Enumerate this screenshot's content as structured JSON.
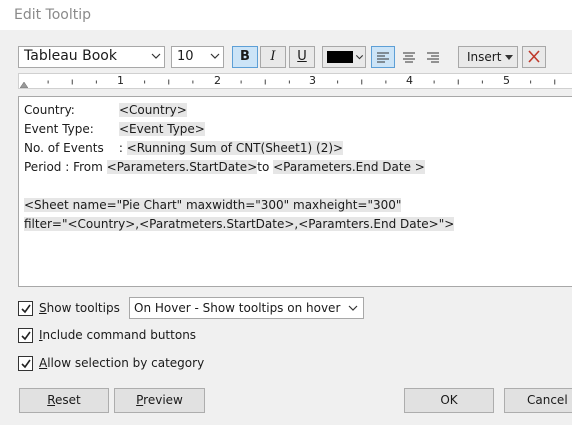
{
  "window": {
    "title": "Edit Tooltip"
  },
  "toolbar": {
    "font_family": "Tableau Book",
    "font_size": "10",
    "bold_label": "B",
    "italic_label": "I",
    "underline_label": "U",
    "text_color": "#000000",
    "insert_label": "Insert"
  },
  "ruler": {
    "marks": [
      "1",
      "2",
      "3",
      "4",
      "5"
    ]
  },
  "editor": {
    "line1": {
      "label": "Country:",
      "field": "<Country>"
    },
    "line2": {
      "label": "Event Type:",
      "field": "<Event Type>"
    },
    "line3": {
      "label": "No. of Events",
      "sep": " : ",
      "field": "<Running Sum of CNT(Sheet1) (2)>"
    },
    "line4": {
      "label": "Period : From ",
      "field1": "<Parameters.StartDate>",
      "mid": "to ",
      "field2": "<Parameters.End Date >"
    },
    "line5": "<Sheet name=\"Pie Chart\" maxwidth=\"300\" maxheight=\"300\"",
    "line6": "filter=\"<Country>,<Paratmeters.StartDate>,<Paramters.End Date>\">"
  },
  "options": {
    "show_tooltips": {
      "label": "Show tooltips",
      "checked": true
    },
    "hover_mode": "On Hover - Show tooltips on hover",
    "include_command_buttons": {
      "label": "Include command buttons",
      "checked": true
    },
    "allow_selection": {
      "label": "Allow selection by category",
      "checked": true
    }
  },
  "buttons": {
    "reset": "Reset",
    "preview": "Preview",
    "ok": "OK",
    "cancel": "Cancel"
  }
}
